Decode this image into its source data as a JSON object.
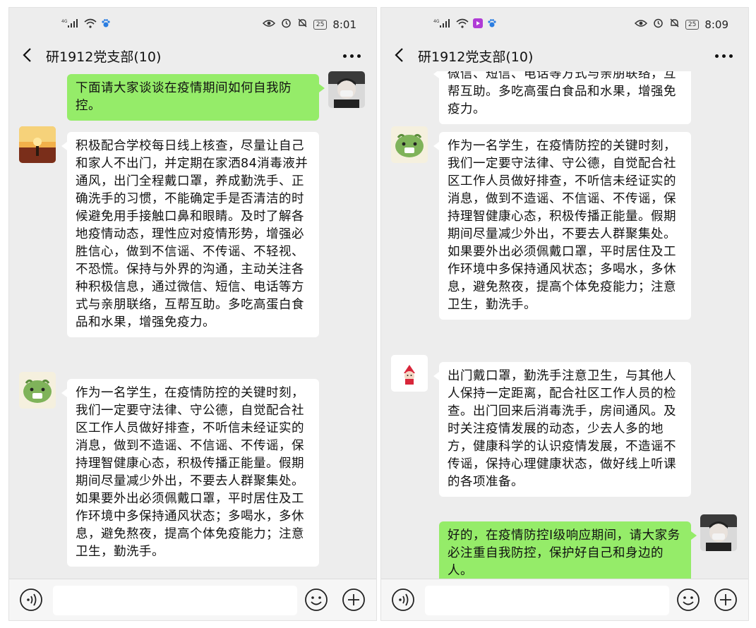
{
  "left_screen": {
    "status": {
      "signal": "4G",
      "time": "8:01",
      "battery": "25"
    },
    "chat_title": "研1912党支部(10)",
    "messages": [
      "下面请大家谈谈在疫情期间如何自我防控。",
      "积极配合学校每日线上核查，尽量让自己和家人不出门，并定期在家洒84消毒液并通风，出门全程戴口罩，养成勤洗手、正确洗手的习惯，不能确定手是否清洁的时候避免用手接触口鼻和眼睛。及时了解各地疫情动态，理性应对疫情形势，增强必胜信心，做到不信谣、不传谣、不轻视、不恐慌。保持与外界的沟通，主动关注各种积极信息，通过微信、短信、电话等方式与亲朋联络，互帮互助。多吃高蛋白食品和水果，增强免疫力。",
      "作为一名学生，在疫情防控的关键时刻，我们一定要守法律、守公德，自觉配合社区工作人员做好排查，不听信未经证实的消息，做到不造谣、不信谣、不传谣，保持理智健康心态，积极传播正能量。假期期间尽量减少外出，不要去人群聚集处。如果要外出必须佩戴口罩，平时居住及工作环境中多保持通风状态；多喝水，多休息，避免熬夜，提高个体免疫能力；注意卫生，勤洗手。"
    ]
  },
  "right_screen": {
    "status": {
      "signal": "4G",
      "time": "8:09",
      "battery": "25"
    },
    "chat_title": "研1912党支部(10)",
    "messages": [
      "微信、短信、电话等方式与亲朋联络，互帮互助。多吃高蛋白食品和水果，增强免疫力。",
      "作为一名学生，在疫情防控的关键时刻，我们一定要守法律、守公德，自觉配合社区工作人员做好排查，不听信未经证实的消息，做到不造谣、不信谣、不传谣，保持理智健康心态，积极传播正能量。假期期间尽量减少外出，不要去人群聚集处。如果要外出必须佩戴口罩，平时居住及工作环境中多保持通风状态；多喝水，多休息，避免熬夜，提高个体免疫能力；注意卫生，勤洗手。",
      "出门戴口罩，勤洗手注意卫生，与其他人人保持一定距离，配合社区工作人员的检查。出门回来后消毒洗手，房间通风。及时关注疫情发展的动态，少去人多的地方，健康科学的认识疫情发展，不造谣不传谣，保持心理健康状态，做好线上听课的各项准备。",
      "好的，在疫情防控I级响应期间，请大家务必注重自我防控，保护好自己和身边的人。"
    ]
  },
  "colors": {
    "sent_bubble": "#95ec69",
    "received_bubble": "#ffffff",
    "background": "#ededed"
  },
  "icons": [
    "back-arrow-icon",
    "more-icon",
    "voice-icon",
    "emoji-icon",
    "plus-icon",
    "wifi-icon",
    "signal-icon",
    "eye-icon",
    "alarm-icon",
    "mute-icon"
  ]
}
